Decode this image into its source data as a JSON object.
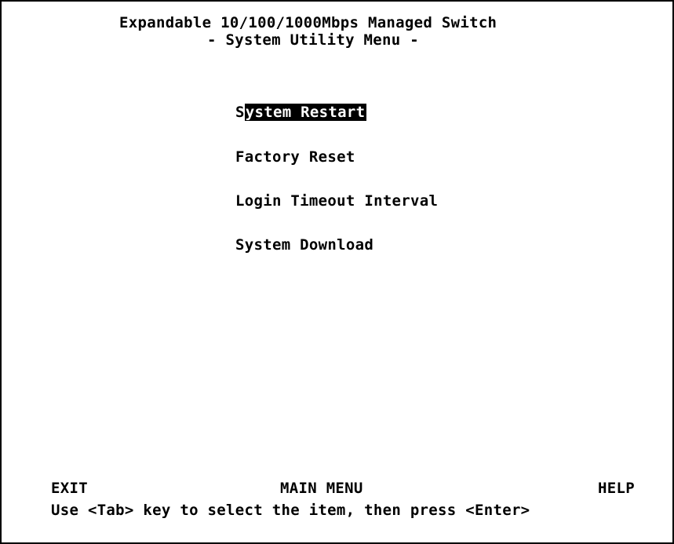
{
  "header": {
    "title": "Expandable 10/100/1000Mbps Managed Switch",
    "subtitle": "- System Utility Menu -"
  },
  "menu": {
    "items": [
      {
        "first_char": "S",
        "rest": "ystem Restart",
        "selected": true
      },
      {
        "label": "Factory Reset",
        "selected": false
      },
      {
        "label": "Login Timeout Interval",
        "selected": false
      },
      {
        "label": "System Download",
        "selected": false
      }
    ]
  },
  "footer": {
    "exit_label": "EXIT",
    "main_menu_label": "MAIN MENU",
    "help_label": "HELP",
    "instruction": "Use <Tab> key to select the item, then press <Enter>"
  },
  "colors": {
    "background": "#ffffff",
    "foreground": "#000000",
    "highlight_bg": "#000000",
    "highlight_fg": "#ffffff"
  }
}
